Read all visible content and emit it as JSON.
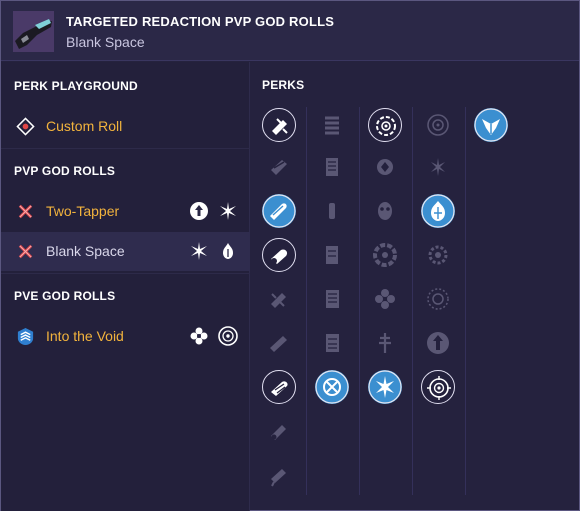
{
  "header": {
    "title": "TARGETED REDACTION PVP GOD ROLLS",
    "subtitle": "Blank Space",
    "weapon_icon": "weapon-thumbnail"
  },
  "sidebar": {
    "perk_playground": {
      "heading": "PERK PLAYGROUND",
      "items": [
        {
          "label": "Custom Roll",
          "icon": "target-diamond-icon"
        }
      ]
    },
    "pvp": {
      "heading": "PVP GOD ROLLS",
      "items": [
        {
          "label": "Two-Tapper",
          "icon": "crossed-x-icon",
          "perks": [
            "arrow-circle-icon",
            "starburst-icon"
          ]
        },
        {
          "label": "Blank Space",
          "icon": "crossed-x-icon",
          "perks": [
            "starburst-icon",
            "flame-burst-icon"
          ]
        }
      ]
    },
    "pve": {
      "heading": "PVE GOD ROLLS",
      "items": [
        {
          "label": "Into the Void",
          "icon": "chevron-shield-icon",
          "perks": [
            "cluster-icon",
            "reticle-icon"
          ]
        }
      ]
    }
  },
  "perks": {
    "heading": "PERKS",
    "colors": {
      "selected": "#3b8fd0",
      "outline": "#e0def0",
      "dim": "#6e6a8c"
    }
  }
}
